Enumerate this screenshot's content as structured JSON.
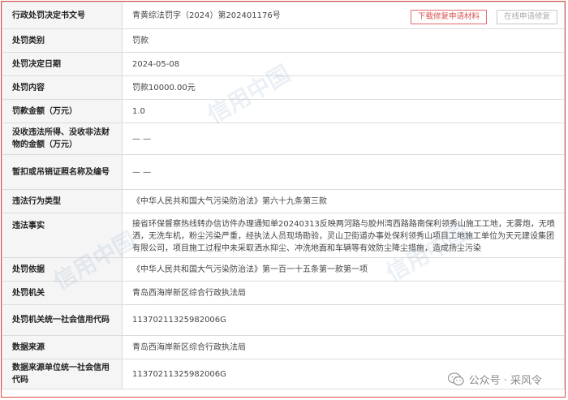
{
  "header": {
    "key": "行政处罚决定书文号",
    "value": "青黄综法罚字（2024）第202401176号",
    "download_label": "下载修复申请材料",
    "online_label": "在线申请修复"
  },
  "rows": [
    {
      "key": "处罚类别",
      "value": "罚款"
    },
    {
      "key": "处罚决定日期",
      "value": "2024-05-08"
    },
    {
      "key": "处罚内容",
      "value": "罚款10000.00元"
    },
    {
      "key": "罚款金额（万元）",
      "value": "1.0"
    },
    {
      "key": "没收违法所得、没收非法财物的金额（万元）",
      "value": "— —"
    },
    {
      "key": "暂扣或吊销证照名称及编号",
      "value": "— —"
    },
    {
      "key": "违法行为类型",
      "value": "《中华人民共和国大气污染防治法》第六十九条第三款"
    },
    {
      "key": "违法事实",
      "value": "接省环保督察热线转办信访件办理通知单20240313反映两河路与胶州湾西路路南保利领秀山施工工地，无雾炮，无喷洒，无洗车机，粉尘污染严重，经执法人员现场勘验，灵山卫街道办事处保利领秀山项目工地施工单位为天元建设集团有限公司，项目施工过程中未采取洒水抑尘、冲洗地面和车辆等有效防尘降尘措施，造成扬尘污染"
    },
    {
      "key": "处罚依据",
      "value": "《中华人民共和国大气污染防治法》第一百一十五条第一款第一项"
    },
    {
      "key": "处罚机关",
      "value": "青岛西海岸新区综合行政执法局"
    },
    {
      "key": "处罚机关统一社会信用代码",
      "value": "11370211325982006G"
    },
    {
      "key": "数据来源",
      "value": "青岛西海岸新区综合行政执法局"
    },
    {
      "key": "数据来源单位统一社会信用代码",
      "value": "11370211325982006G"
    }
  ],
  "watermark": "信用中国",
  "wechat_badge": {
    "text": "公众号 · 采风令",
    "icon": "wechat-icon"
  }
}
